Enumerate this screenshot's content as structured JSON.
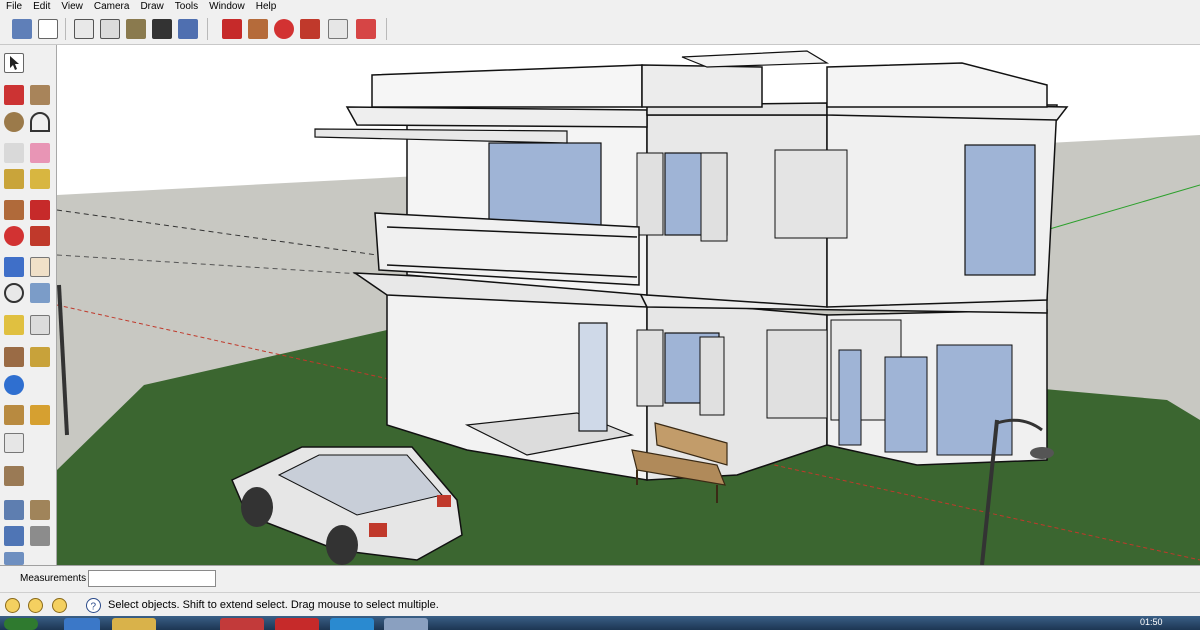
{
  "menubar": {
    "items": [
      "File",
      "Edit",
      "View",
      "Camera",
      "Draw",
      "Tools",
      "Window",
      "Help"
    ]
  },
  "measurements": {
    "label": "Measurements",
    "value": ""
  },
  "status": {
    "text": "Select objects. Shift to extend select. Drag mouse to select multiple."
  },
  "taskbar": {
    "clock": "01:50"
  },
  "colors": {
    "chrome": "#f0f0f0",
    "sky": "#ffffff",
    "ground": "#c8c8c2",
    "grass": "#3b6630",
    "wall": "#f2f2f2",
    "glass": "#9fb4d6",
    "axis_red": "#c0392b",
    "axis_green": "#2ca02c",
    "taskbar": "#1d3653"
  },
  "toolbar_icons": [
    "iso-view-icon",
    "top-view-icon",
    "front-view-icon",
    "right-view-icon",
    "back-view-icon",
    "left-view-icon",
    "xray-style-icon",
    "wireframe-style-icon",
    "shaded-style-icon",
    "textured-style-icon",
    "monochrome-style-icon",
    "move-icon",
    "pushpull-icon",
    "rotate-icon",
    "followme-icon",
    "scale-icon",
    "offset-icon"
  ],
  "left_tool_icons": [
    "select-icon",
    "line-icon",
    "rectangle-icon",
    "circle-icon",
    "arc-icon",
    "make-component-icon",
    "eraser-icon",
    "tape-measure-icon",
    "paint-bucket-icon",
    "pushpull-icon",
    "move-icon",
    "rotate-icon",
    "followme-icon",
    "orbit-icon",
    "pan-icon",
    "zoom-icon",
    "zoom-extents-icon",
    "dimension-icon",
    "text-icon",
    "walk-icon",
    "position-camera-icon",
    "google-earth-icon",
    "add-location-icon",
    "get-models-icon",
    "share-model-icon",
    "section-plane-icon",
    "sandbox-icon",
    "components-icon",
    "materials-icon",
    "layers-icon"
  ]
}
